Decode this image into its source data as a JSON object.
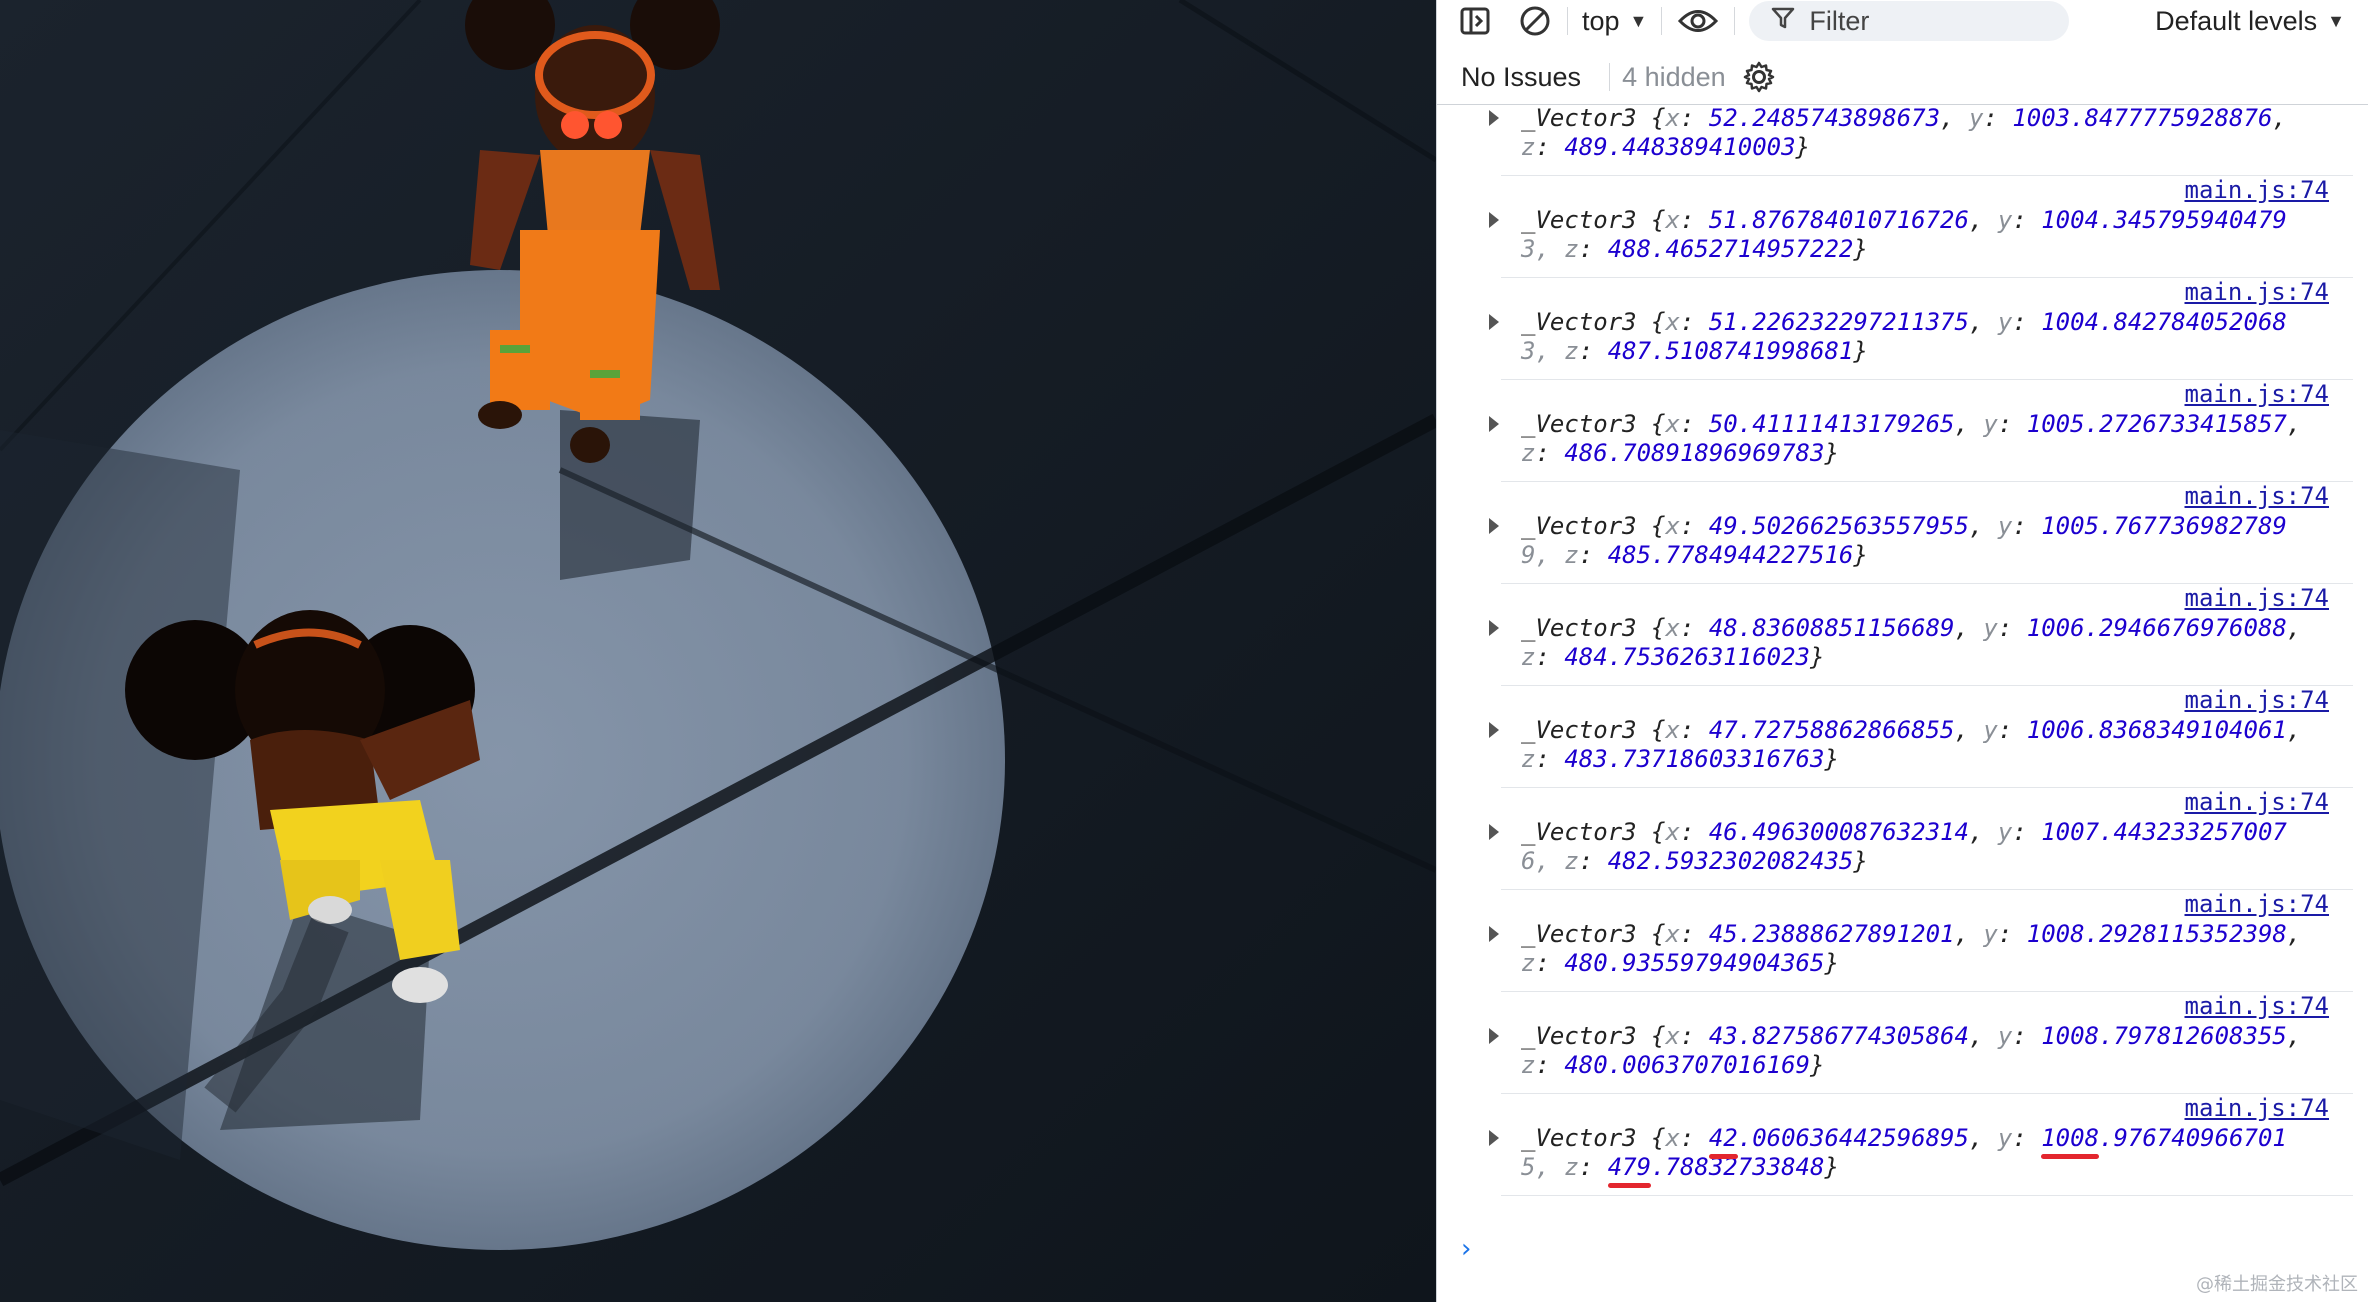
{
  "toolbar": {
    "context": "top",
    "filter_placeholder": "Filter",
    "levels": "Default levels"
  },
  "status": {
    "no_issues": "No Issues",
    "hidden": "4 hidden"
  },
  "console": {
    "source_label": "main.js:74",
    "messages": [
      {
        "l1": [
          "_Vector3 {",
          "x",
          ": ",
          "52.2485743898673",
          ", ",
          "y",
          ": ",
          "1003.8477775928876",
          ","
        ],
        "l2": [
          "z",
          ": ",
          "489.448389410003",
          "}"
        ]
      },
      {
        "l1": [
          "_Vector3 {",
          "x",
          ": ",
          "51.876784010716726",
          ", ",
          "y",
          ": ",
          "1004.345795940479",
          ""
        ],
        "l2": [
          "3, z",
          ": ",
          "488.4652714957222",
          "}"
        ]
      },
      {
        "l1": [
          "_Vector3 {",
          "x",
          ": ",
          "51.226232297211375",
          ", ",
          "y",
          ": ",
          "1004.842784052068",
          ""
        ],
        "l2": [
          "3, z",
          ": ",
          "487.5108741998681",
          "}"
        ]
      },
      {
        "l1": [
          "_Vector3 {",
          "x",
          ": ",
          "50.41111413179265",
          ", ",
          "y",
          ": ",
          "1005.2726733415857",
          ","
        ],
        "l2": [
          "z",
          ": ",
          "486.70891896969783",
          "}"
        ]
      },
      {
        "l1": [
          "_Vector3 {",
          "x",
          ": ",
          "49.502662563557955",
          ", ",
          "y",
          ": ",
          "1005.767736982789",
          ""
        ],
        "l2": [
          "9, z",
          ": ",
          "485.7784944227516",
          "}"
        ]
      },
      {
        "l1": [
          "_Vector3 {",
          "x",
          ": ",
          "48.83608851156689",
          ", ",
          "y",
          ": ",
          "1006.2946676976088",
          ","
        ],
        "l2": [
          "z",
          ": ",
          "484.7536263116023",
          "}"
        ]
      },
      {
        "l1": [
          "_Vector3 {",
          "x",
          ": ",
          "47.72758862866855",
          ", ",
          "y",
          ": ",
          "1006.8368349104061",
          ","
        ],
        "l2": [
          "z",
          ": ",
          "483.73718603316763",
          "}"
        ]
      },
      {
        "l1": [
          "_Vector3 {",
          "x",
          ": ",
          "46.496300087632314",
          ", ",
          "y",
          ": ",
          "1007.443233257007",
          ""
        ],
        "l2": [
          "6, z",
          ": ",
          "482.5932302082435",
          "}"
        ]
      },
      {
        "l1": [
          "_Vector3 {",
          "x",
          ": ",
          "45.23888627891201",
          ", ",
          "y",
          ": ",
          "1008.2928115352398",
          ","
        ],
        "l2": [
          "z",
          ": ",
          "480.93559794904365",
          "}"
        ]
      },
      {
        "l1": [
          "_Vector3 {",
          "x",
          ": ",
          "43.827586774305864",
          ", ",
          "y",
          ": ",
          "1008.797812608355",
          ","
        ],
        "l2": [
          "z",
          ": ",
          "480.0063707016169",
          "}"
        ]
      },
      {
        "l1": [
          "_Vector3 {",
          "x",
          ": ",
          "42.060636442596895",
          ", ",
          "y",
          ": ",
          "1008.976740966701",
          ""
        ],
        "l2": [
          "5, z",
          ": ",
          "479.78832733848",
          "}"
        ]
      }
    ],
    "prompt_symbol": "›"
  },
  "watermark": "@稀土掘金技术社区",
  "colors": {
    "console_value": "#1c00cf",
    "console_link": "#1a1aa6",
    "annotation_red": "#e3262e"
  }
}
